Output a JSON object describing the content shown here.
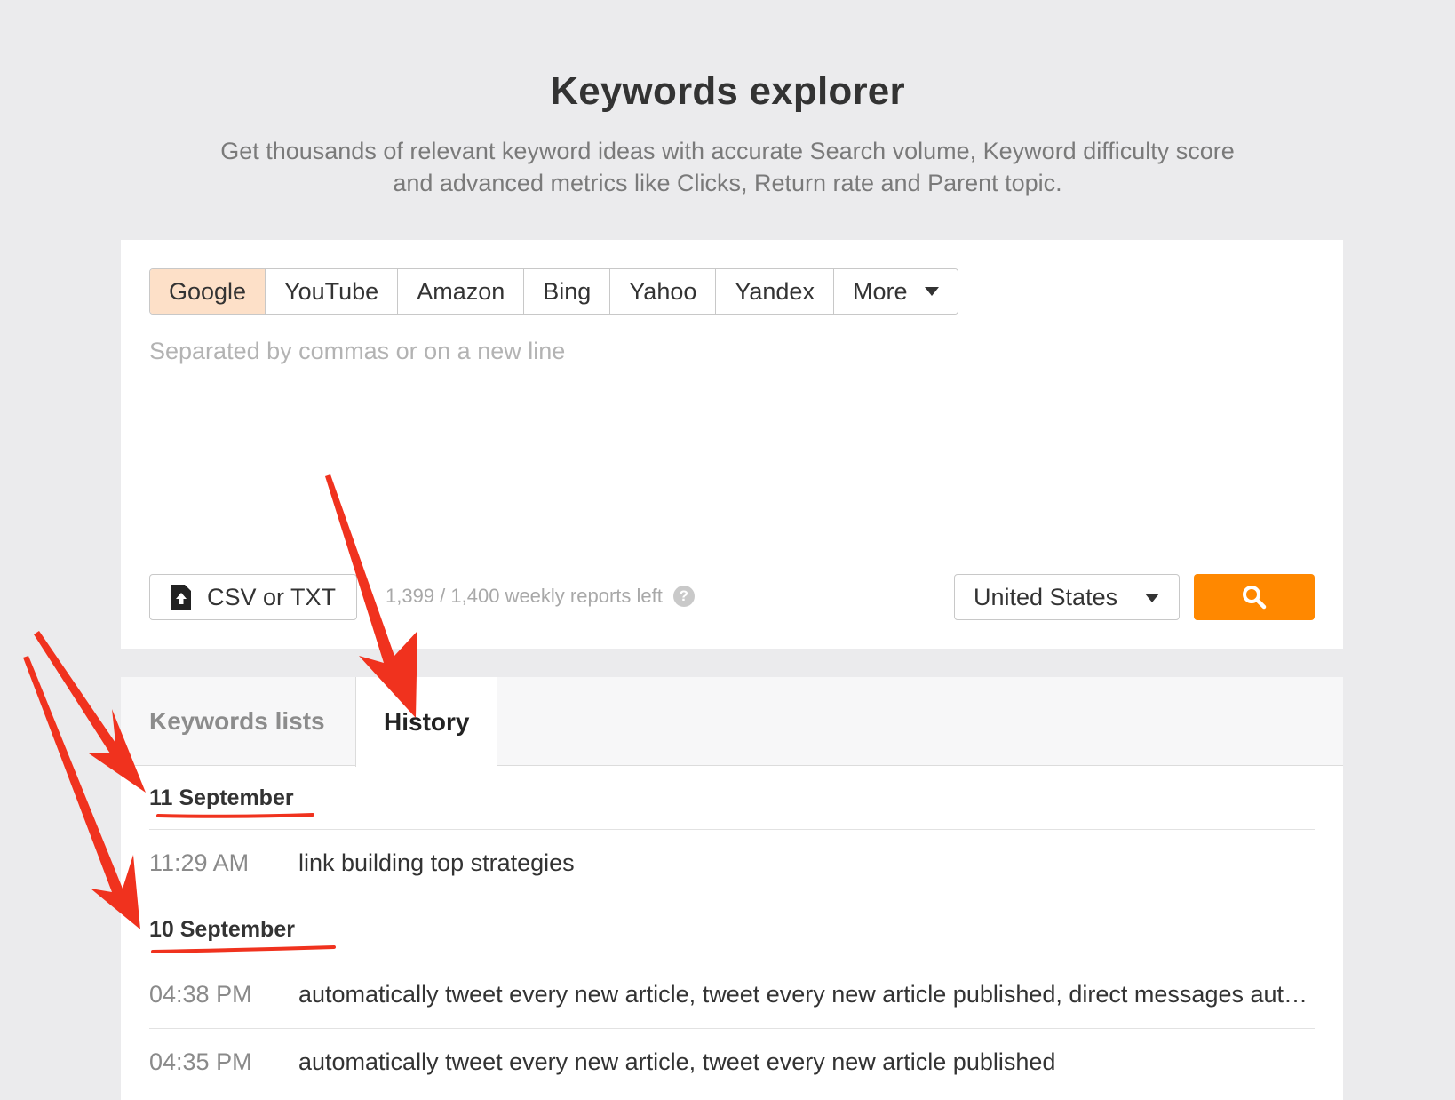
{
  "header": {
    "title": "Keywords explorer",
    "subtitle": "Get thousands of relevant keyword ideas with accurate Search volume, Keyword difficulty score and advanced metrics like Clicks, Return rate and Parent topic."
  },
  "search": {
    "engines": [
      "Google",
      "YouTube",
      "Amazon",
      "Bing",
      "Yahoo",
      "Yandex"
    ],
    "active_engine": "Google",
    "more_label": "More",
    "placeholder": "Separated by commas or on a new line",
    "upload_label": "CSV or TXT",
    "reports_left": "1,399 / 1,400 weekly reports left",
    "help_glyph": "?",
    "country": "United States"
  },
  "tabs": {
    "lists_label": "Keywords lists",
    "history_label": "History",
    "active": "History"
  },
  "history": [
    {
      "date": "11 September",
      "entries": [
        {
          "time": "11:29 AM",
          "query": "link building top strategies"
        }
      ]
    },
    {
      "date": "10 September",
      "entries": [
        {
          "time": "04:38 PM",
          "query": "automatically tweet every new article, tweet every new article published, direct messages automatically tweet"
        },
        {
          "time": "04:35 PM",
          "query": "automatically tweet every new article, tweet every new article published"
        }
      ]
    }
  ],
  "colors": {
    "accent": "#ff8800",
    "active_engine_bg": "#fde0c8",
    "annotation": "#f0321e"
  },
  "icons": {
    "upload": "upload-file-icon",
    "search": "search-icon",
    "help": "help-icon",
    "dropdown": "caret-down-icon"
  }
}
